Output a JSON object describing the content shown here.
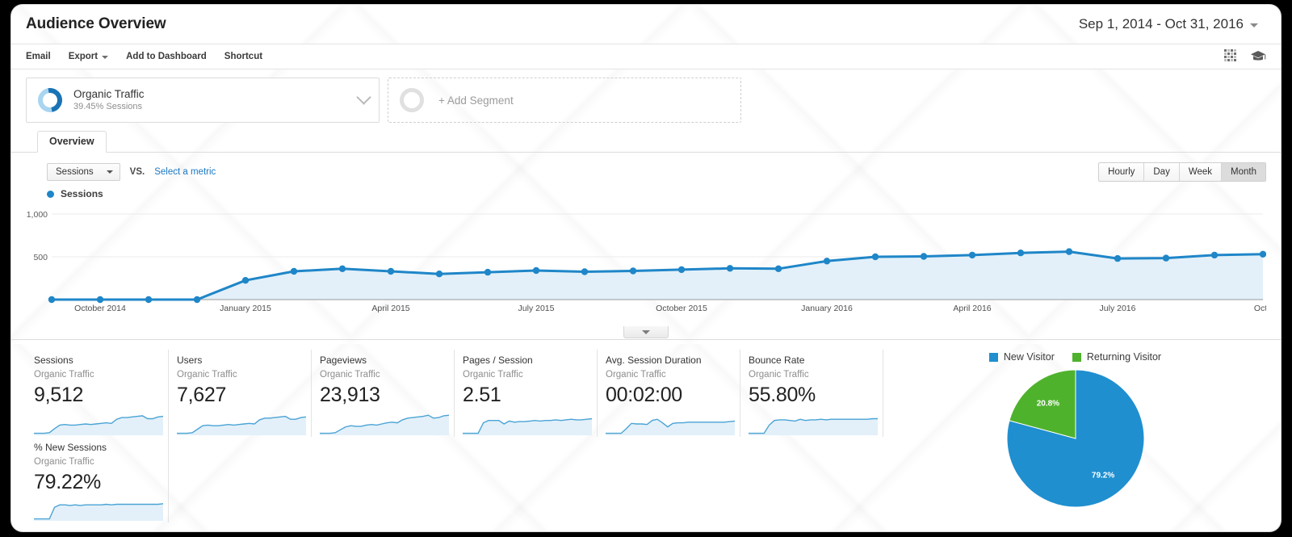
{
  "header": {
    "title": "Audience Overview",
    "date_range": "Sep 1, 2014 - Oct 31, 2016"
  },
  "actionbar": {
    "items": [
      {
        "label": "Email",
        "has_caret": false
      },
      {
        "label": "Export",
        "has_caret": true
      },
      {
        "label": "Add to Dashboard",
        "has_caret": false
      },
      {
        "label": "Shortcut",
        "has_caret": false
      }
    ],
    "icons": [
      "qr-code-icon",
      "graduation-cap-icon"
    ]
  },
  "segments": {
    "applied": {
      "name": "Organic Traffic",
      "sub": "39.45% Sessions"
    },
    "add_label": "+ Add Segment"
  },
  "tabs": [
    {
      "label": "Overview",
      "active": true
    }
  ],
  "metric_controls": {
    "selected_metric": "Sessions",
    "vs_label": "VS.",
    "select_metric_link": "Select a metric",
    "granularity": [
      {
        "label": "Hourly",
        "active": false
      },
      {
        "label": "Day",
        "active": false
      },
      {
        "label": "Week",
        "active": false
      },
      {
        "label": "Month",
        "active": true
      }
    ]
  },
  "chart_legend": {
    "label": "Sessions"
  },
  "chart_data": {
    "type": "line",
    "title": "Sessions",
    "xlabel": "",
    "ylabel": "Sessions",
    "ylim": [
      0,
      1000
    ],
    "yticks": [
      500,
      1000
    ],
    "ytick_labels": [
      "500",
      "1,000"
    ],
    "grid": true,
    "legend_position": "top-left",
    "series": [
      {
        "name": "Sessions",
        "color": "#1f86c8",
        "x": [
          "Sep 2014",
          "Oct 2014",
          "Nov 2014",
          "Dec 2014",
          "Jan 2015",
          "Feb 2015",
          "Mar 2015",
          "Apr 2015",
          "May 2015",
          "Jun 2015",
          "Jul 2015",
          "Aug 2015",
          "Sep 2015",
          "Oct 2015",
          "Nov 2015",
          "Dec 2015",
          "Jan 2016",
          "Feb 2016",
          "Mar 2016",
          "Apr 2016",
          "May 2016",
          "Jun 2016",
          "Jul 2016",
          "Aug 2016",
          "Sep 2016",
          "Oct 2016"
        ],
        "values": [
          0,
          0,
          0,
          0,
          225,
          330,
          360,
          330,
          300,
          320,
          340,
          325,
          335,
          350,
          365,
          360,
          450,
          500,
          505,
          520,
          545,
          560,
          480,
          485,
          520,
          530
        ]
      }
    ],
    "xtick_labels": [
      "October 2014",
      "January 2015",
      "April 2015",
      "July 2015",
      "October 2015",
      "January 2016",
      "April 2016",
      "July 2016",
      "Octo"
    ]
  },
  "metric_cards": [
    {
      "title": "Sessions",
      "sub": "Organic Traffic",
      "value": "9,512"
    },
    {
      "title": "Users",
      "sub": "Organic Traffic",
      "value": "7,627"
    },
    {
      "title": "Pageviews",
      "sub": "Organic Traffic",
      "value": "23,913"
    },
    {
      "title": "Pages / Session",
      "sub": "Organic Traffic",
      "value": "2.51"
    },
    {
      "title": "Avg. Session Duration",
      "sub": "Organic Traffic",
      "value": "00:02:00"
    },
    {
      "title": "Bounce Rate",
      "sub": "Organic Traffic",
      "value": "55.80%"
    },
    {
      "title": "% New Sessions",
      "sub": "Organic Traffic",
      "value": "79.22%"
    }
  ],
  "pie_chart": {
    "type": "pie",
    "title": "",
    "legend_position": "top",
    "labels": [
      "New Visitor",
      "Returning Visitor"
    ],
    "values": [
      79.2,
      20.8
    ],
    "value_labels": [
      "79.2%",
      "20.8%"
    ],
    "colors": [
      "#1f8fd0",
      "#4fb22d"
    ]
  },
  "colors": {
    "accent_blue": "#1f86c8",
    "link_blue": "#1b78c2",
    "pie_blue": "#1f8fd0",
    "pie_green": "#4fb22d",
    "area_fill": "#e3f0f9"
  }
}
